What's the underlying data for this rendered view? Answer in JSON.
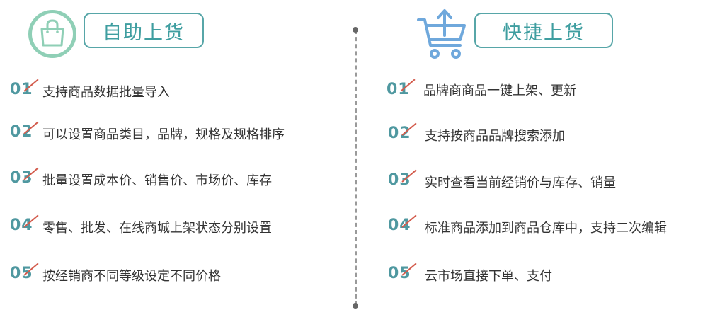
{
  "left": {
    "title": "自助上货",
    "icon": "shopping-bag-icon",
    "items": [
      {
        "num": "01",
        "text": "支持商品数据批量导入"
      },
      {
        "num": "02",
        "text": "可以设置商品类目，品牌，规格及规格排序"
      },
      {
        "num": "03",
        "text": "批量设置成本价、销售价、市场价、库存"
      },
      {
        "num": "04",
        "text": "零售、批发、在线商城上架状态分别设置"
      },
      {
        "num": "05",
        "text": "按经销商不同等级设定不同价格"
      }
    ]
  },
  "right": {
    "title": "快捷上货",
    "icon": "cart-upload-icon",
    "items": [
      {
        "num": "01",
        "text": "品牌商商品一键上架、更新"
      },
      {
        "num": "02",
        "text": "支持按商品品牌搜索添加"
      },
      {
        "num": "03",
        "text": "实时查看当前经销价与库存、销量"
      },
      {
        "num": "04",
        "text": "标准商品添加到商品仓库中，支持二次编辑"
      },
      {
        "num": "05",
        "text": "云市场直接下单、支付"
      }
    ]
  },
  "colors": {
    "accent": "#57a6a8",
    "number": "#4f98a0",
    "slash": "#d35b4c",
    "cart": "#6fa8dc"
  }
}
